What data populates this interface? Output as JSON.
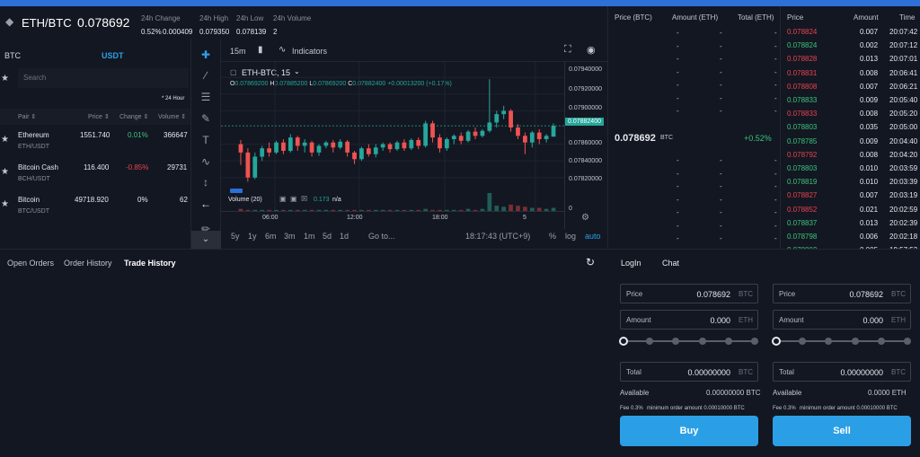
{
  "ticker": {
    "symbol": "ETH/BTC",
    "price": "0.078692",
    "change_label": "24h Change",
    "change_pct": "0.52%",
    "change_abs": "0.000409",
    "high_label": "24h High",
    "high": "0.079350",
    "low_label": "24h Low",
    "low": "0.078139",
    "volume_label": "24h Volume",
    "volume": "2"
  },
  "pairs": {
    "tabs": [
      {
        "label": "BTC"
      },
      {
        "label": "USDT"
      }
    ],
    "search_placeholder": "Search",
    "period_note": "* 24 Hour",
    "headers": {
      "pair": "Pair ⇕",
      "price": "Price ⇕",
      "change": "Change ⇕",
      "volume": "Volume ⇕"
    },
    "rows": [
      {
        "name": "Ethereum",
        "sub": "ETH/USDT",
        "price": "1551.740",
        "change": "0.01%",
        "volume": "366647",
        "dir": "up"
      },
      {
        "name": "Bitcoin Cash",
        "sub": "BCH/USDT",
        "price": "116.400",
        "change": "-0.85%",
        "volume": "29731",
        "dir": "down"
      },
      {
        "name": "Bitcoin",
        "sub": "BTC/USDT",
        "price": "49718.920",
        "change": "0%",
        "volume": "62",
        "dir": "flat"
      }
    ]
  },
  "chart": {
    "interval": "15m",
    "indicators_label": "Indicators",
    "legend_symbol": "ETH-BTC, 15",
    "ohlc": {
      "o_label": "O",
      "o": "0.07869200",
      "h_label": "H",
      "h": "0.07885200",
      "l_label": "L",
      "l": "0.07869200",
      "c_label": "C",
      "c": "0.07882400",
      "chg": "+0.00013200 (+0.17%)"
    },
    "price_ticks": [
      "0.07940000",
      "0.07920000",
      "0.07900000",
      "0.07860000",
      "0.07840000",
      "0.07820000"
    ],
    "last_price_label": "0.07882400",
    "volume_label": "Volume (20)",
    "volume_value": "0.173",
    "volume_na": "n/a",
    "volume_axis_zero": "0",
    "time_ticks": [
      "06:00",
      "12:00",
      "18:00",
      "5"
    ],
    "ranges": [
      "5y",
      "1y",
      "6m",
      "3m",
      "1m",
      "5d",
      "1d"
    ],
    "goto_label": "Go to...",
    "clock": "18:17:43 (UTC+9)",
    "pct_label": "%",
    "log_label": "log",
    "auto_label": "auto",
    "colors": {
      "up": "#26a69a",
      "down": "#ef5350",
      "last": "#26a69a"
    }
  },
  "chart_data": {
    "type": "candlestick",
    "ylim": [
      0.0781,
      0.0795
    ],
    "candles": [
      {
        "o": 0.0786,
        "c": 0.0785,
        "h": 0.07865,
        "l": 0.07835
      },
      {
        "o": 0.0785,
        "c": 0.0782,
        "h": 0.07855,
        "l": 0.07815
      },
      {
        "o": 0.0782,
        "c": 0.07845,
        "h": 0.0785,
        "l": 0.07818
      },
      {
        "o": 0.07845,
        "c": 0.07855,
        "h": 0.07858,
        "l": 0.0784
      },
      {
        "o": 0.07855,
        "c": 0.0785,
        "h": 0.07862,
        "l": 0.07845
      },
      {
        "o": 0.0785,
        "c": 0.07862,
        "h": 0.07864,
        "l": 0.07848
      },
      {
        "o": 0.07862,
        "c": 0.07852,
        "h": 0.07866,
        "l": 0.07848
      },
      {
        "o": 0.07852,
        "c": 0.07868,
        "h": 0.07872,
        "l": 0.0785
      },
      {
        "o": 0.07868,
        "c": 0.07858,
        "h": 0.0787,
        "l": 0.07852
      },
      {
        "o": 0.07858,
        "c": 0.07862,
        "h": 0.07866,
        "l": 0.0785
      },
      {
        "o": 0.07862,
        "c": 0.0785,
        "h": 0.07864,
        "l": 0.07845
      },
      {
        "o": 0.0785,
        "c": 0.07858,
        "h": 0.0786,
        "l": 0.07846
      },
      {
        "o": 0.07858,
        "c": 0.07862,
        "h": 0.07864,
        "l": 0.07855
      },
      {
        "o": 0.07862,
        "c": 0.07856,
        "h": 0.07865,
        "l": 0.0785
      },
      {
        "o": 0.07856,
        "c": 0.07863,
        "h": 0.07866,
        "l": 0.07854
      },
      {
        "o": 0.07863,
        "c": 0.0785,
        "h": 0.07865,
        "l": 0.07845
      },
      {
        "o": 0.0785,
        "c": 0.07842,
        "h": 0.07852,
        "l": 0.07836
      },
      {
        "o": 0.07842,
        "c": 0.07855,
        "h": 0.07857,
        "l": 0.0784
      },
      {
        "o": 0.07855,
        "c": 0.07848,
        "h": 0.0786,
        "l": 0.07845
      },
      {
        "o": 0.07848,
        "c": 0.07856,
        "h": 0.0786,
        "l": 0.07844
      },
      {
        "o": 0.07856,
        "c": 0.0786,
        "h": 0.07862,
        "l": 0.07852
      },
      {
        "o": 0.0786,
        "c": 0.07854,
        "h": 0.07862,
        "l": 0.0785
      },
      {
        "o": 0.07854,
        "c": 0.07862,
        "h": 0.07864,
        "l": 0.07852
      },
      {
        "o": 0.07862,
        "c": 0.07855,
        "h": 0.07866,
        "l": 0.07852
      },
      {
        "o": 0.07855,
        "c": 0.07865,
        "h": 0.07867,
        "l": 0.07853
      },
      {
        "o": 0.07865,
        "c": 0.07858,
        "h": 0.07868,
        "l": 0.07854
      },
      {
        "o": 0.07858,
        "c": 0.07885,
        "h": 0.07888,
        "l": 0.07856
      },
      {
        "o": 0.07885,
        "c": 0.07868,
        "h": 0.07888,
        "l": 0.07862
      },
      {
        "o": 0.07868,
        "c": 0.07855,
        "h": 0.07872,
        "l": 0.0785
      },
      {
        "o": 0.07855,
        "c": 0.07866,
        "h": 0.07868,
        "l": 0.07852
      },
      {
        "o": 0.07866,
        "c": 0.0787,
        "h": 0.07872,
        "l": 0.0786
      },
      {
        "o": 0.0787,
        "c": 0.07864,
        "h": 0.07874,
        "l": 0.0786
      },
      {
        "o": 0.07864,
        "c": 0.07875,
        "h": 0.07877,
        "l": 0.07862
      },
      {
        "o": 0.07875,
        "c": 0.0787,
        "h": 0.0788,
        "l": 0.07866
      },
      {
        "o": 0.0787,
        "c": 0.07876,
        "h": 0.07878,
        "l": 0.07868
      },
      {
        "o": 0.07876,
        "c": 0.07886,
        "h": 0.07938,
        "l": 0.07874
      },
      {
        "o": 0.07886,
        "c": 0.07896,
        "h": 0.079,
        "l": 0.0788
      },
      {
        "o": 0.07896,
        "c": 0.079,
        "h": 0.07906,
        "l": 0.0789
      },
      {
        "o": 0.079,
        "c": 0.0788,
        "h": 0.07902,
        "l": 0.07875
      },
      {
        "o": 0.0788,
        "c": 0.0787,
        "h": 0.07884,
        "l": 0.07866
      },
      {
        "o": 0.0787,
        "c": 0.07862,
        "h": 0.07874,
        "l": 0.07848
      },
      {
        "o": 0.07862,
        "c": 0.07874,
        "h": 0.07876,
        "l": 0.07856
      },
      {
        "o": 0.07874,
        "c": 0.07866,
        "h": 0.07878,
        "l": 0.0786
      },
      {
        "o": 0.07866,
        "c": 0.0787,
        "h": 0.07872,
        "l": 0.07862
      },
      {
        "o": 0.07869,
        "c": 0.07882,
        "h": 0.07885,
        "l": 0.07869
      }
    ],
    "volumes": [
      0.02,
      0.01,
      0.01,
      0.01,
      0.01,
      0.01,
      0.01,
      0.01,
      0.01,
      0.01,
      0.01,
      0.01,
      0.01,
      0.01,
      0.01,
      0.01,
      0.01,
      0.01,
      0.01,
      0.01,
      0.01,
      0.01,
      0.01,
      0.01,
      0.01,
      0.01,
      0.02,
      0.01,
      0.01,
      0.01,
      0.01,
      0.01,
      0.02,
      0.01,
      0.02,
      0.17,
      0.05,
      0.04,
      0.06,
      0.05,
      0.04,
      0.03,
      0.03,
      0.02,
      0.03
    ]
  },
  "orderbook": {
    "headers": {
      "price": "Price (BTC)",
      "amount": "Amount (ETH)",
      "total": "Total (ETH)"
    },
    "asks_count": 7,
    "bids_count": 8,
    "placeholder": "-",
    "mid_price": "0.078692",
    "mid_unit": "BTC",
    "mid_change": "+0.52%"
  },
  "trades": {
    "headers": {
      "price": "Price",
      "amount": "Amount",
      "time": "Time"
    },
    "rows": [
      {
        "price": "0.078824",
        "amount": "0.007",
        "time": "20:07:42",
        "side": "sell"
      },
      {
        "price": "0.078824",
        "amount": "0.002",
        "time": "20:07:12",
        "side": "buy"
      },
      {
        "price": "0.078828",
        "amount": "0.013",
        "time": "20:07:01",
        "side": "sell"
      },
      {
        "price": "0.078831",
        "amount": "0.008",
        "time": "20:06:41",
        "side": "sell"
      },
      {
        "price": "0.078808",
        "amount": "0.007",
        "time": "20:06:21",
        "side": "sell"
      },
      {
        "price": "0.078833",
        "amount": "0.009",
        "time": "20:05:40",
        "side": "buy"
      },
      {
        "price": "0.078833",
        "amount": "0.008",
        "time": "20:05:20",
        "side": "sell"
      },
      {
        "price": "0.078803",
        "amount": "0.035",
        "time": "20:05:00",
        "side": "buy"
      },
      {
        "price": "0.078785",
        "amount": "0.009",
        "time": "20:04:40",
        "side": "buy"
      },
      {
        "price": "0.078792",
        "amount": "0.008",
        "time": "20:04:20",
        "side": "sell"
      },
      {
        "price": "0.078803",
        "amount": "0.010",
        "time": "20:03:59",
        "side": "buy"
      },
      {
        "price": "0.078819",
        "amount": "0.010",
        "time": "20:03:39",
        "side": "buy"
      },
      {
        "price": "0.078827",
        "amount": "0.007",
        "time": "20:03:19",
        "side": "sell"
      },
      {
        "price": "0.078852",
        "amount": "0.021",
        "time": "20:02:59",
        "side": "sell"
      },
      {
        "price": "0.078837",
        "amount": "0.013",
        "time": "20:02:39",
        "side": "buy"
      },
      {
        "price": "0.078798",
        "amount": "0.006",
        "time": "20:02:18",
        "side": "buy"
      },
      {
        "price": "0.078802",
        "amount": "0.005",
        "time": "19:57:53",
        "side": "buy"
      }
    ]
  },
  "history": {
    "tabs": [
      {
        "label": "Open Orders"
      },
      {
        "label": "Order History"
      },
      {
        "label": "Trade History"
      }
    ]
  },
  "trade": {
    "tabs": [
      {
        "label": "LogIn"
      },
      {
        "label": "Chat"
      }
    ],
    "buy": {
      "price_label": "Price",
      "price": "0.078692",
      "price_unit": "BTC",
      "amount_label": "Amount",
      "amount": "0.000",
      "amount_unit": "ETH",
      "total_label": "Total",
      "total": "0.00000000",
      "total_unit": "BTC",
      "available_label": "Available",
      "available": "0.00000000 BTC",
      "fee_label": "Fee 0.3%",
      "min_order": "minimum order amount 0.00010000 BTC",
      "button": "Buy"
    },
    "sell": {
      "price_label": "Price",
      "price": "0.078692",
      "price_unit": "BTC",
      "amount_label": "Amount",
      "amount": "0.000",
      "amount_unit": "ETH",
      "total_label": "Total",
      "total": "0.00000000",
      "total_unit": "BTC",
      "available_label": "Available",
      "available": "0.0000 ETH",
      "fee_label": "Fee 0.3%",
      "min_order": "minimum order amount 0.00010000 BTC",
      "button": "Sell"
    },
    "slider_level": 0
  }
}
